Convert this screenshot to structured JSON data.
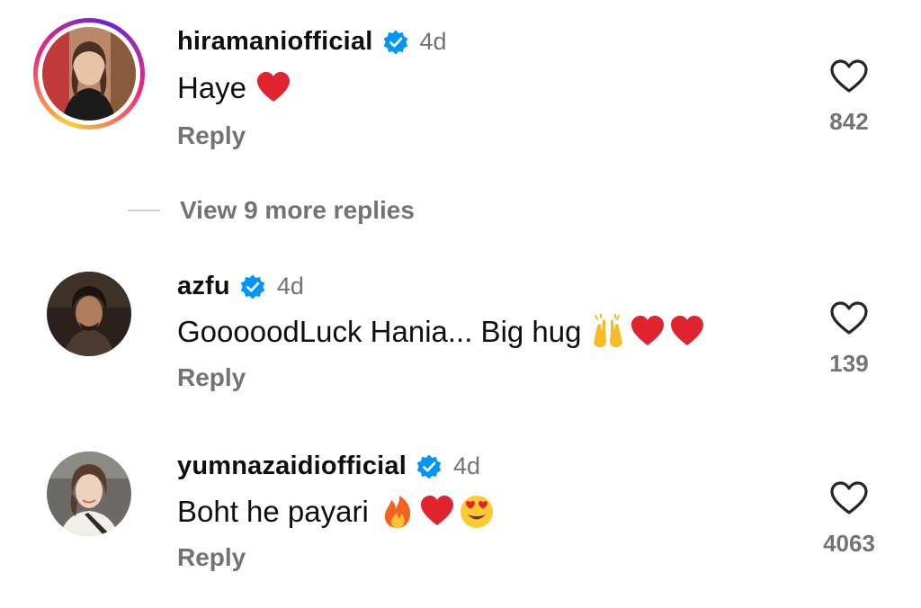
{
  "comments": [
    {
      "username": "hiramaniofficial",
      "time": "4d",
      "text": "Haye",
      "emojis": [
        "red-heart-emoji"
      ],
      "reply_label": "Reply",
      "like_count": "842",
      "has_story_ring": true
    },
    {
      "username": "azfu",
      "time": "4d",
      "text": "GooooodLuck Hania... Big hug",
      "emojis": [
        "raising-hands-emoji",
        "red-heart-emoji",
        "red-heart-emoji"
      ],
      "reply_label": "Reply",
      "like_count": "139",
      "has_story_ring": false
    },
    {
      "username": "yumnazaidiofficial",
      "time": "4d",
      "text": "Boht he payari",
      "emojis": [
        "fire-emoji",
        "red-heart-emoji",
        "heart-eyes-emoji"
      ],
      "reply_label": "Reply",
      "like_count": "4063",
      "has_story_ring": false
    }
  ],
  "view_more_replies": "View 9 more replies",
  "colors": {
    "verified_blue": "#0095f6",
    "secondary_text": "#737373",
    "heart_red": "#e0242f"
  },
  "icons": {
    "verified": "verified-badge-icon",
    "like": "heart-outline-icon"
  }
}
